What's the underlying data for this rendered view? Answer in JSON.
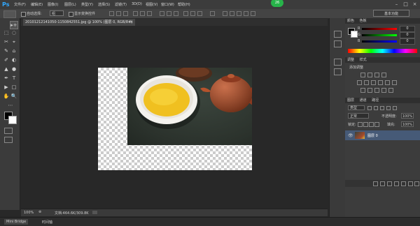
{
  "app": {
    "logo": "Ps",
    "menu": [
      "文件(F)",
      "编辑(E)",
      "图像(I)",
      "图层(L)",
      "类型(Y)",
      "选择(S)",
      "滤镜(T)",
      "3D(D)",
      "视图(V)",
      "窗口(W)",
      "帮助(H)"
    ],
    "update_badge": "26",
    "window_controls": [
      "–",
      "□",
      "×"
    ]
  },
  "options": {
    "auto_select_label": "自动选择:",
    "auto_select_value": "组",
    "show_transform_label": "显示变换控件",
    "workspace": "基本功能"
  },
  "toolbox": {
    "tools": [
      "▸+",
      "⬚",
      "◌",
      "✂",
      "⌖",
      "✎",
      "⌂",
      "✐",
      "◐",
      "▲",
      "●",
      "✒",
      "T",
      "▶",
      "□",
      "✋",
      "🔍",
      "⋯"
    ]
  },
  "document": {
    "tab_label": "20101212141050-1150842551.jpg @ 100% (图层 0, RGB/8#) *",
    "tab_close": "×",
    "zoom": "100%",
    "doc_info": "文档:464.6K/309.8K"
  },
  "bottom": {
    "tabs": [
      "Mini Bridge",
      "时间轴"
    ]
  },
  "color_panel": {
    "tabs": [
      "颜色",
      "色板"
    ],
    "sliders": [
      {
        "label": "R",
        "value": "0",
        "color": "#c0392b"
      },
      {
        "label": "G",
        "value": "0",
        "color": "#27ae60"
      },
      {
        "label": "B",
        "value": "0",
        "color": "#2e6fd8"
      }
    ]
  },
  "adjust_panel": {
    "tabs": [
      "调整",
      "样式"
    ],
    "title": "添加调整"
  },
  "layers_panel": {
    "tabs": [
      "图层",
      "通道",
      "路径"
    ],
    "kind": "类型",
    "blend_mode": "正常",
    "opacity_label": "不透明度:",
    "opacity_value": "100%",
    "lock_label": "锁定:",
    "fill_label": "填充:",
    "fill_value": "100%",
    "layer_name": "图层 0"
  }
}
